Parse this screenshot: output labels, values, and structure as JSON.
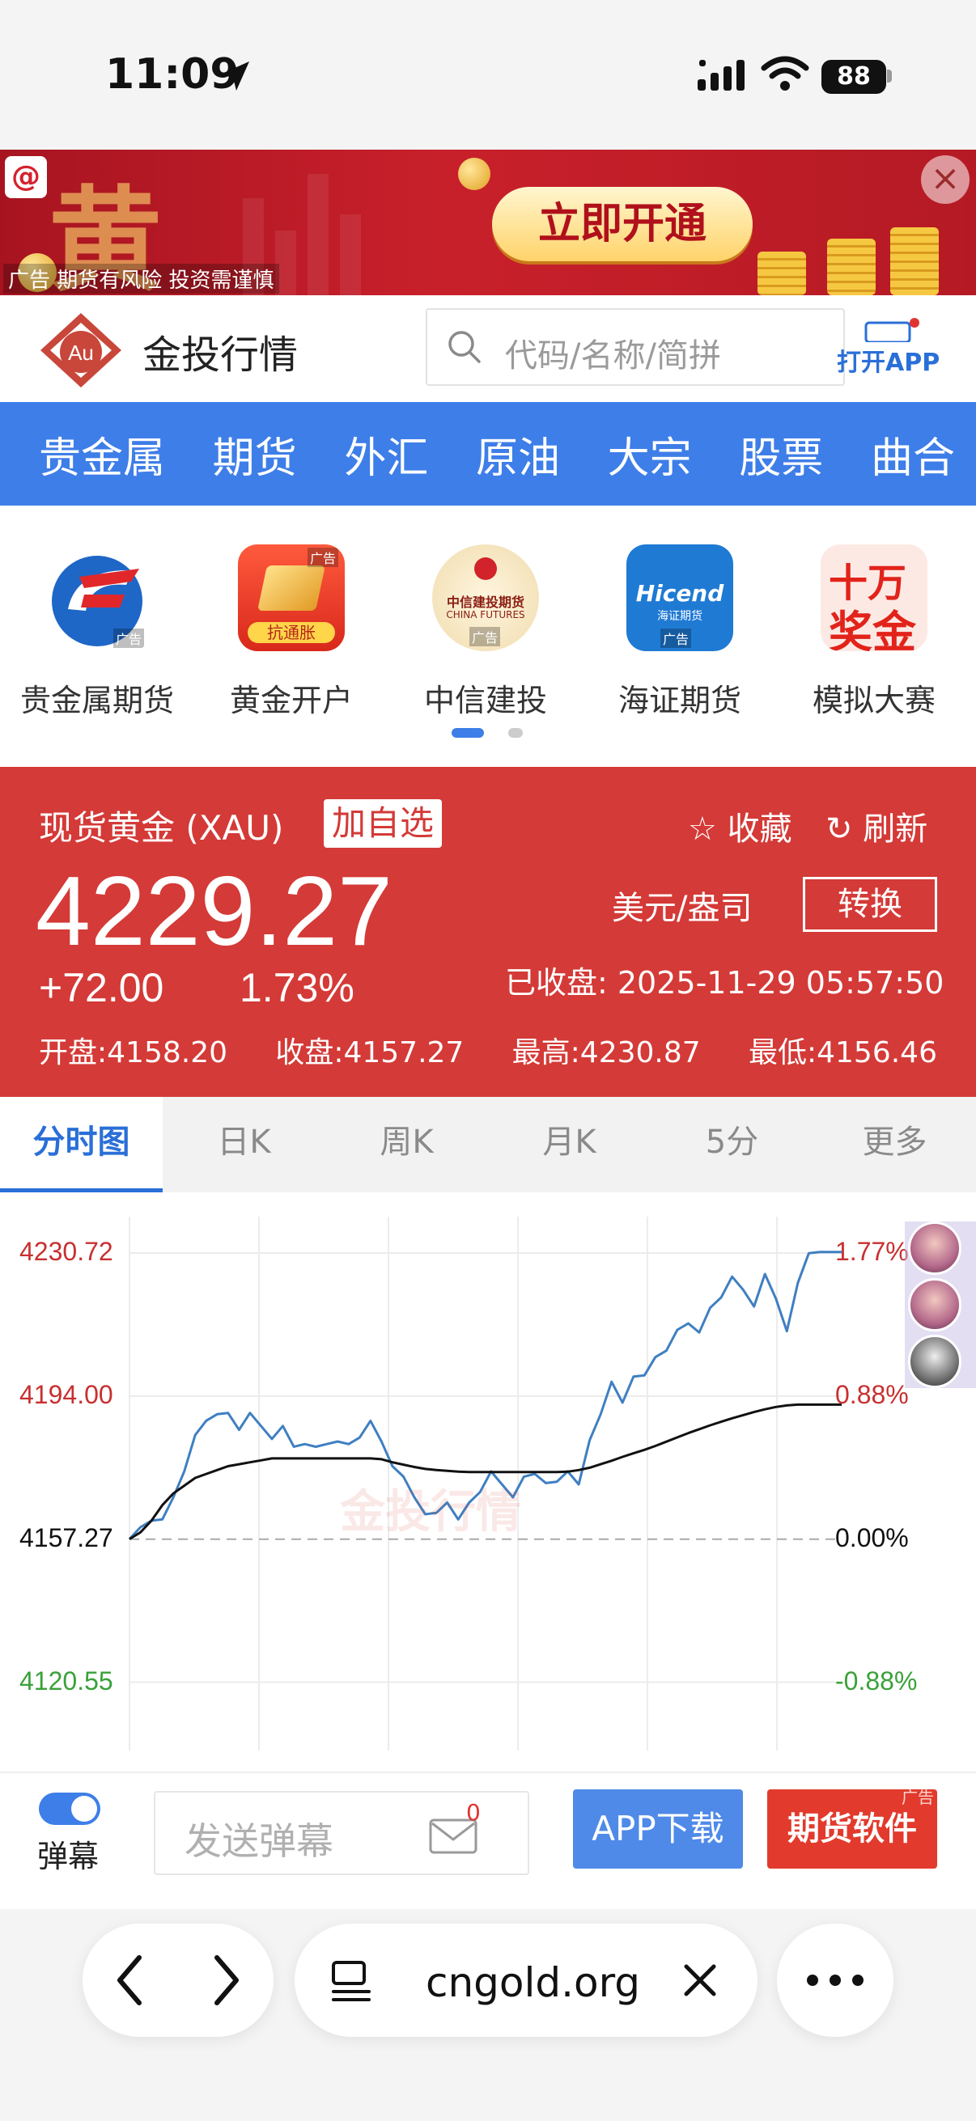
{
  "status_bar": {
    "time": "11:09",
    "battery": "88"
  },
  "ad_banner": {
    "big_char": "黄",
    "cta": "立即开通",
    "ad_label": "广告",
    "disclaimer": "期货有风险 投资需谨慎"
  },
  "header": {
    "logo_text": "Au",
    "site_name": "金投行情",
    "search_placeholder": "代码/名称/简拼",
    "open_app": "打开APP"
  },
  "nav": {
    "items": [
      "贵金属",
      "期货",
      "外汇",
      "原油",
      "大宗",
      "股票",
      "曲合"
    ]
  },
  "shortcuts": [
    {
      "label": "贵金属期货",
      "ad": "广告"
    },
    {
      "label": "黄金开户",
      "ad": "广告",
      "badge": "抗通胀"
    },
    {
      "label": "中信建投",
      "ad": "广告",
      "badge_top": "中信建投期货",
      "badge_bottom": "CHINA FUTURES"
    },
    {
      "label": "海证期货",
      "ad": "广告",
      "badge_top": "Hicend",
      "badge_bottom": "海证期货"
    },
    {
      "label": "模拟大赛",
      "badge_top": "十万",
      "badge_bottom": "奖金"
    }
  ],
  "quote": {
    "name": "现货黄金 (XAU)",
    "add_watch": "加自选",
    "favorite": "收藏",
    "refresh": "刷新",
    "price": "4229.27",
    "unit": "美元/盎司",
    "convert": "转换",
    "change": "+72.00",
    "change_pct": "1.73%",
    "closed_at": "已收盘: 2025-11-29 05:57:50",
    "open": "开盘:4158.20",
    "close": "收盘:4157.27",
    "high": "最高:4230.87",
    "low": "最低:4156.46"
  },
  "tabs": [
    "分时图",
    "日K",
    "周K",
    "月K",
    "5分",
    "更多"
  ],
  "chart_data": {
    "type": "line",
    "y_left_labels": [
      "4230.72",
      "4194.00",
      "4157.27",
      "4120.55"
    ],
    "y_right_labels": [
      "1.77%",
      "0.88%",
      "0.00%",
      "-0.88%"
    ],
    "ylim": [
      4103,
      4238
    ],
    "baseline": 4157.27,
    "watermark": "金投行情",
    "colors": {
      "price": "#3f7fc2",
      "average": "#111111",
      "up": "#c83030",
      "down": "#3aa13a"
    },
    "series": [
      {
        "values": [
          4157.3,
          4160,
          4163,
          4161,
          4168,
          4176,
          4183,
          4188,
          4191,
          4189,
          4186,
          4188,
          4186,
          4184,
          4185,
          4181,
          4183,
          4180,
          4182,
          4184,
          4181,
          4184,
          4186,
          4182,
          4177,
          4172,
          4168,
          4165,
          4163,
          4167,
          4164,
          4166,
          4170,
          4173,
          4171,
          4169,
          4172,
          4174,
          4173,
          4171,
          4175,
          4173,
          4182,
          4190,
          4196,
          4192,
          4200,
          4198,
          4204,
          4207,
          4210,
          4213,
          4212,
          4216,
          4220,
          4223,
          4221,
          4218,
          4224,
          4219,
          4212,
          4222,
          4231,
          4231,
          4231,
          4231
        ]
      },
      {
        "values": [
          4157.3,
          4159,
          4162,
          4166,
          4169,
          4171,
          4173,
          4174,
          4175,
          4176,
          4176.5,
          4177,
          4177.5,
          4178,
          4178,
          4178,
          4178,
          4178,
          4178,
          4178,
          4178,
          4178,
          4178,
          4177.8,
          4177,
          4176.4,
          4175.8,
          4175.3,
          4175,
          4174.8,
          4174.6,
          4174.5,
          4174.5,
          4174.5,
          4174.5,
          4174.5,
          4174.5,
          4174.5,
          4174.5,
          4174.5,
          4174.6,
          4175,
          4175.6,
          4176.5,
          4177.4,
          4178.4,
          4179.3,
          4180.2,
          4181.2,
          4182.3,
          4183.4,
          4184.5,
          4185.5,
          4186.5,
          4187.4,
          4188.3,
          4189.1,
          4189.9,
          4190.6,
          4191.2,
          4191.6,
          4191.8,
          4191.8,
          4191.8,
          4191.8,
          4191.8
        ]
      }
    ]
  },
  "danmu": {
    "toggle_label": "弹幕",
    "placeholder": "发送弹幕",
    "count": "0",
    "app_download": "APP下载",
    "futures_software": "期货软件",
    "ad_tag": "广告"
  },
  "browser": {
    "url": "cngold.org"
  }
}
